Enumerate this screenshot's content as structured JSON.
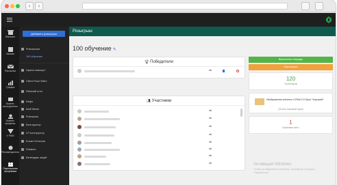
{
  "browser": {
    "back_glyph": "‹",
    "forward_glyph": "›"
  },
  "sidebar_primary": {
    "items": [
      {
        "label": "Магазин",
        "icon": "store-icon"
      },
      {
        "label": "Заказы",
        "icon": "orders-icon"
      },
      {
        "label": "Рассылки",
        "icon": "mailing-icon"
      },
      {
        "label": "Трафик",
        "icon": "traffic-icon"
      },
      {
        "label": "Бизнес инструменты",
        "icon": "tools-icon"
      },
      {
        "label": "Бизнес профиль",
        "icon": "profile-icon"
      },
      {
        "label": "V РАМ",
        "icon": "vpam-icon"
      },
      {
        "label": "Рекомендатель",
        "icon": "recommend-icon"
      },
      {
        "label": "Партнерская программа",
        "icon": "partner-icon"
      }
    ]
  },
  "sidebar_secondary": {
    "add_button": "Добавить розыгрыш",
    "items": [
      {
        "label": "Розыгрыши",
        "active": false
      },
      {
        "label": "100 обучение",
        "active": true
      },
      {
        "label": "Нужна помощь?",
        "active": false
      },
      {
        "label": "Client Fussi Video",
        "active": false
      },
      {
        "label": "Рабочий стол",
        "active": false
      },
      {
        "label": "Инфо",
        "active": false
      },
      {
        "label": "Шаб Меню",
        "active": false
      },
      {
        "label": "Розыгрыш",
        "active": false
      },
      {
        "label": "Конструктор",
        "active": false
      },
      {
        "label": "LP конструктор",
        "active": false
      },
      {
        "label": "Блоки Остатков",
        "active": false
      },
      {
        "label": "Rotators",
        "active": false
      },
      {
        "label": "Календарь акций",
        "active": false
      }
    ]
  },
  "header": {
    "title": "Розыгрыш"
  },
  "page": {
    "title": "100 обучение"
  },
  "winners": {
    "title": "Победители",
    "rows": [
      {
        "badge": "vk"
      }
    ]
  },
  "participants": {
    "title": "Участники",
    "rows": [
      {
        "badge": "vk"
      },
      {
        "badge": "vk"
      },
      {
        "badge": "vk"
      },
      {
        "badge": "vk"
      },
      {
        "badge": "vk"
      },
      {
        "badge": "vk"
      },
      {
        "badge": "vk"
      },
      {
        "badge": "vk"
      }
    ]
  },
  "actions": {
    "primary": "Выполнить награды",
    "secondary": "Перезапуск"
  },
  "stats": {
    "participants_count": "120",
    "participants_label": "Участников",
    "prize_text": "Изображение антенны V-PAM 2.0 Приз \"Хороший\"",
    "prize_sub": "(Очень хороший приз)",
    "winners_count": "1",
    "winners_label": "Призовых мест"
  },
  "watermark": {
    "title": "Активация Windows",
    "subtitle": "Чтобы активировать Windows, перейдите в раздел \"Параметры\"."
  },
  "colors": {
    "header_green": "#0f5a4e",
    "primary_blue": "#2f6fd6",
    "action_green": "#55b34a",
    "action_orange": "#f1a23a",
    "brand_green": "#1e9f46",
    "count_color": "#3aa24b",
    "winners_count_color": "#d14b4b"
  }
}
